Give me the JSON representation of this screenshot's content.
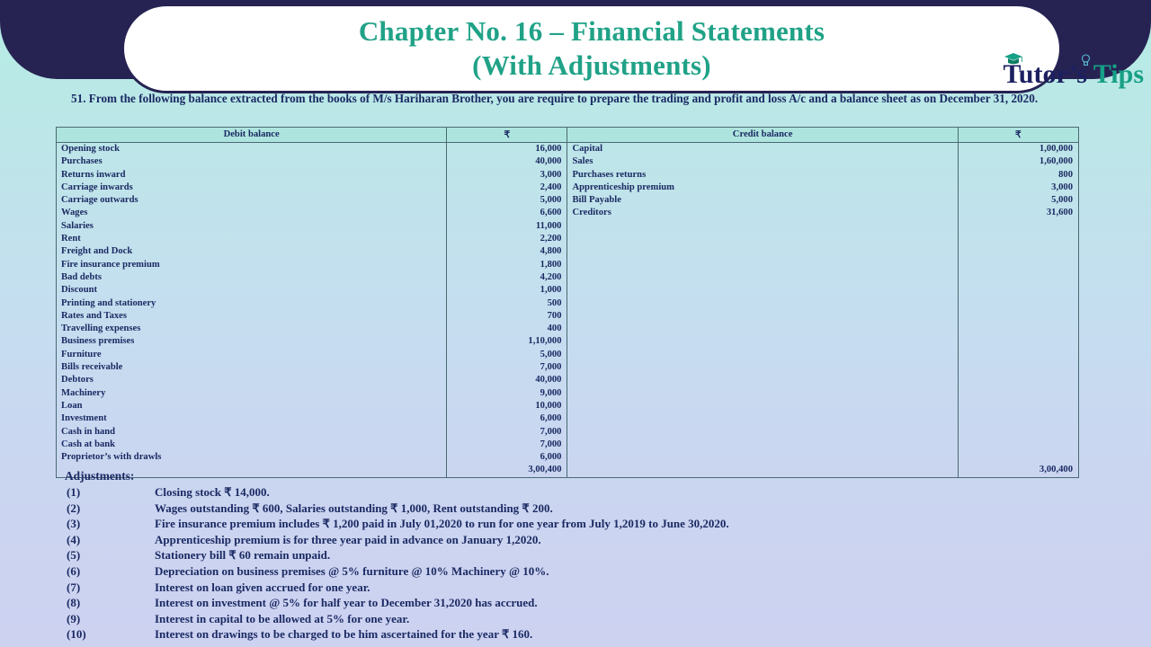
{
  "header": {
    "title_line1": "Chapter No. 16 – Financial Statements",
    "title_line2": "(With Adjustments)",
    "logo_part1": "T",
    "logo_part2": "utor’s ",
    "logo_part3": "T",
    "logo_part4": "ips",
    "title_color": "#20a287",
    "banner_color": "#262353"
  },
  "question": {
    "text": "51. From the following balance extracted from the books of M/s Hariharan Brother, you are require to prepare the trading and profit and loss A/c and a balance sheet as on December 31, 2020."
  },
  "table": {
    "headers": {
      "debit": "Debit balance",
      "debit_amount": "₹",
      "credit": "Credit balance",
      "credit_amount": "₹"
    },
    "debit_rows": [
      {
        "name": "Opening stock",
        "amount": "16,000"
      },
      {
        "name": "Purchases",
        "amount": "40,000"
      },
      {
        "name": "Returns inward",
        "amount": "3,000"
      },
      {
        "name": "Carriage inwards",
        "amount": "2,400"
      },
      {
        "name": "Carriage outwards",
        "amount": "5,000"
      },
      {
        "name": "Wages",
        "amount": "6,600"
      },
      {
        "name": "Salaries",
        "amount": "11,000"
      },
      {
        "name": "Rent",
        "amount": "2,200"
      },
      {
        "name": "Freight and Dock",
        "amount": "4,800"
      },
      {
        "name": "Fire insurance premium",
        "amount": "1,800"
      },
      {
        "name": "Bad debts",
        "amount": "4,200"
      },
      {
        "name": "Discount",
        "amount": "1,000"
      },
      {
        "name": "Printing and stationery",
        "amount": "500"
      },
      {
        "name": "Rates and Taxes",
        "amount": "700"
      },
      {
        "name": "Travelling expenses",
        "amount": "400"
      },
      {
        "name": "Business premises",
        "amount": "1,10,000"
      },
      {
        "name": "Furniture",
        "amount": "5,000"
      },
      {
        "name": "Bills receivable",
        "amount": "7,000"
      },
      {
        "name": "Debtors",
        "amount": "40,000"
      },
      {
        "name": "Machinery",
        "amount": "9,000"
      },
      {
        "name": "Loan",
        "amount": "10,000"
      },
      {
        "name": "Investment",
        "amount": "6,000"
      },
      {
        "name": "Cash in hand",
        "amount": "7,000"
      },
      {
        "name": "Cash at bank",
        "amount": "7,000"
      },
      {
        "name": "Proprietor’s with drawls",
        "amount": "6,000"
      },
      {
        "name": "",
        "amount": "3,00,400"
      }
    ],
    "credit_rows": [
      {
        "name": "Capital",
        "amount": "1,00,000"
      },
      {
        "name": "Sales",
        "amount": "1,60,000"
      },
      {
        "name": "Purchases returns",
        "amount": "800"
      },
      {
        "name": "Apprenticeship premium",
        "amount": "3,000"
      },
      {
        "name": "Bill Payable",
        "amount": "5,000"
      },
      {
        "name": "Creditors",
        "amount": "31,600"
      },
      {
        "name": "",
        "amount": ""
      },
      {
        "name": "",
        "amount": ""
      },
      {
        "name": "",
        "amount": ""
      },
      {
        "name": "",
        "amount": ""
      },
      {
        "name": "",
        "amount": ""
      },
      {
        "name": "",
        "amount": ""
      },
      {
        "name": "",
        "amount": ""
      },
      {
        "name": "",
        "amount": ""
      },
      {
        "name": "",
        "amount": ""
      },
      {
        "name": "",
        "amount": ""
      },
      {
        "name": "",
        "amount": ""
      },
      {
        "name": "",
        "amount": ""
      },
      {
        "name": "",
        "amount": ""
      },
      {
        "name": "",
        "amount": ""
      },
      {
        "name": "",
        "amount": ""
      },
      {
        "name": "",
        "amount": ""
      },
      {
        "name": "",
        "amount": ""
      },
      {
        "name": "",
        "amount": ""
      },
      {
        "name": "",
        "amount": ""
      },
      {
        "name": "",
        "amount": "3,00,400"
      }
    ]
  },
  "adjustments": {
    "heading": "Adjustments:",
    "items": [
      {
        "num": "(1)",
        "text": "Closing stock ₹ 14,000."
      },
      {
        "num": "(2)",
        "text": "Wages outstanding ₹ 600, Salaries outstanding ₹ 1,000, Rent outstanding ₹ 200."
      },
      {
        "num": "(3)",
        "text": "Fire insurance premium includes ₹ 1,200 paid in July 01,2020 to run for one year from July 1,2019 to June 30,2020."
      },
      {
        "num": "(4)",
        "text": "Apprenticeship premium is for three year paid in advance on January 1,2020."
      },
      {
        "num": "(5)",
        "text": "Stationery bill ₹ 60 remain unpaid."
      },
      {
        "num": "(6)",
        "text": "Depreciation on business premises @ 5% furniture @ 10% Machinery @ 10%."
      },
      {
        "num": "(7)",
        "text": "Interest on loan given accrued for one year."
      },
      {
        "num": "(8)",
        "text": "Interest on investment @ 5% for half year to December 31,2020 has accrued."
      },
      {
        "num": "(9)",
        "text": "Interest in capital to be allowed at 5% for one year."
      },
      {
        "num": "(10)",
        "text": "Interest on drawings to be charged to be him ascertained for the year ₹ 160."
      }
    ]
  }
}
